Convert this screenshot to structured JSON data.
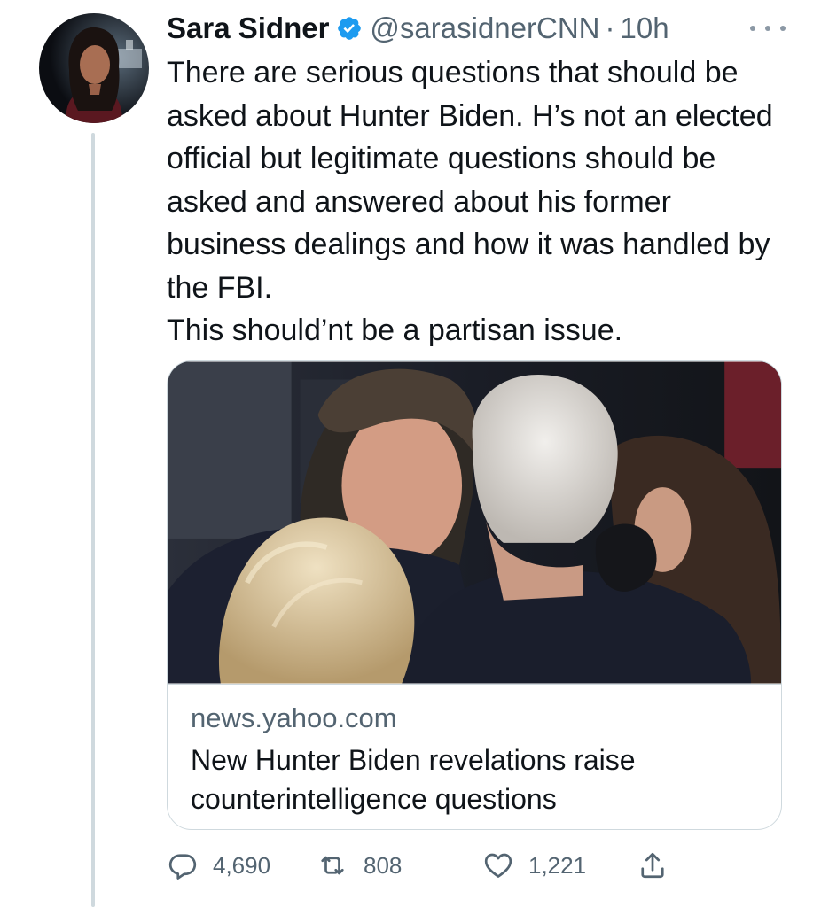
{
  "tweet": {
    "author": {
      "display_name": "Sara Sidner",
      "handle": "@sarasidnerCNN",
      "verified": true
    },
    "separator": "·",
    "timestamp": "10h",
    "text_lines": [
      "There are serious questions that should be asked about Hunter Biden. H’s not an elected official but legitimate questions should be asked and answered about his former business dealings and how it was handled by the FBI.",
      "This should’nt be a partisan issue."
    ],
    "link_card": {
      "domain": "news.yahoo.com",
      "title": "New Hunter Biden revelations raise counterintelligence questions",
      "image": "photo of people embracing outdoors"
    },
    "actions": {
      "reply_count": "4,690",
      "retweet_count": "808",
      "like_count": "1,221"
    }
  },
  "icons": {
    "verified": "verified-badge-icon",
    "more": "more-icon",
    "reply": "reply-icon",
    "retweet": "retweet-icon",
    "like": "heart-icon",
    "share": "share-icon"
  },
  "colors": {
    "verified_blue": "#1d9bf0",
    "secondary_text": "#536471",
    "border": "#cfd9de",
    "primary_text": "#0f1419"
  }
}
